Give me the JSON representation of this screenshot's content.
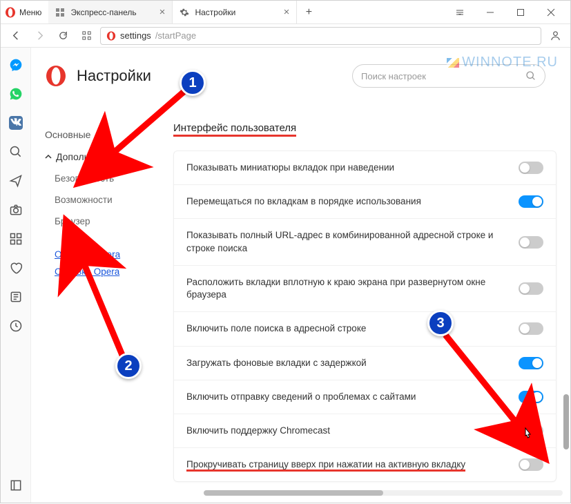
{
  "menu_label": "Меню",
  "tabs": [
    {
      "label": "Экспресс-панель",
      "icon": "speed-dial"
    },
    {
      "label": "Настройки",
      "icon": "gear"
    }
  ],
  "address": {
    "protocol": "settings",
    "path": "/startPage"
  },
  "page_title": "Настройки",
  "search_placeholder": "Поиск настроек",
  "nav": {
    "basic": "Основные",
    "advanced": "Дополнительно",
    "security": "Безопасность",
    "features": "Возможности",
    "browser": "Браузер",
    "rate": "Оценить Opera",
    "help": "Справка Opera"
  },
  "section_title": "Интерфейс пользователя",
  "rows": [
    {
      "label": "Показывать миниатюры вкладок при наведении",
      "on": false
    },
    {
      "label": "Перемещаться по вкладкам в порядке использования",
      "on": true
    },
    {
      "label": "Показывать полный URL-адрес в комбинированной адресной строке и строке поиска",
      "on": false
    },
    {
      "label": "Расположить вкладки вплотную к краю экрана при развернутом окне браузера",
      "on": false
    },
    {
      "label": "Включить поле поиска в адресной строке",
      "on": false
    },
    {
      "label": "Загружать фоновые вкладки с задержкой",
      "on": true
    },
    {
      "label": "Включить отправку сведений о проблемах с сайтами",
      "on": true
    },
    {
      "label": "Включить поддержку Chromecast",
      "on": false
    },
    {
      "label": "Прокручивать страницу вверх при нажатии на активную вкладку",
      "on": false
    }
  ],
  "watermark": "WINNOTE.RU",
  "annotations": {
    "n1": "1",
    "n2": "2",
    "n3": "3"
  }
}
